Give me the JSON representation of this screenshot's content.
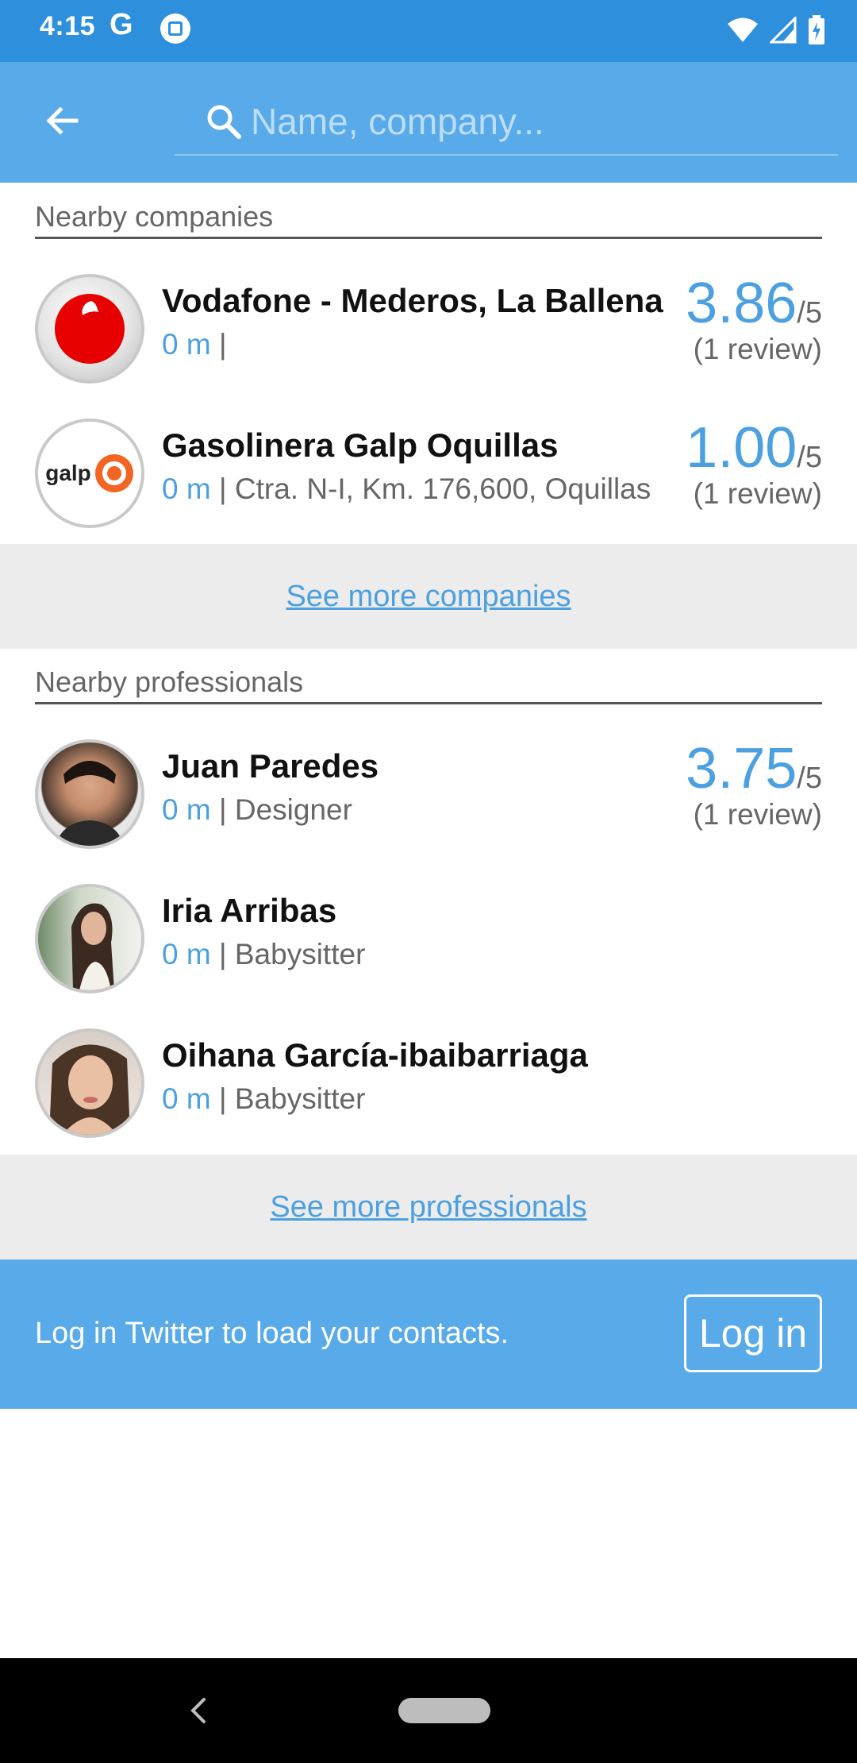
{
  "status_bar": {
    "time": "4:15",
    "g_label": "G",
    "icons": [
      "google-icon",
      "gallery-icon",
      "wifi-icon",
      "signal-icon",
      "battery-icon"
    ]
  },
  "search": {
    "placeholder": "Name, company..."
  },
  "companies": {
    "section_title": "Nearby companies",
    "items": [
      {
        "name": "Vodafone - Mederos, La Ballena",
        "distance": "0 m",
        "separator": "|",
        "detail": "",
        "rating": "3.86",
        "rating_max": "/5",
        "reviews": "(1 review)"
      },
      {
        "name": "Gasolinera Galp Oquillas",
        "distance": "0 m",
        "separator": "|",
        "detail": "Ctra. N-I, Km. 176,600, Oquillas",
        "rating": "1.00",
        "rating_max": "/5",
        "reviews": "(1 review)"
      }
    ],
    "see_more": "See more companies"
  },
  "galp_logo_text": "galp",
  "professionals": {
    "section_title": "Nearby professionals",
    "items": [
      {
        "name": "Juan Paredes",
        "distance": "0 m",
        "separator": "|",
        "detail": "Designer",
        "rating": "3.75",
        "rating_max": "/5",
        "reviews": "(1 review)"
      },
      {
        "name": "Iria Arribas",
        "distance": "0 m",
        "separator": "|",
        "detail": "Babysitter"
      },
      {
        "name": "Oihana García-ibaibarriaga",
        "distance": "0 m",
        "separator": "|",
        "detail": "Babysitter"
      }
    ],
    "see_more": "See more professionals"
  },
  "twitter": {
    "message": "Log in Twitter to load your contacts.",
    "login_label": "Log in"
  },
  "colors": {
    "status_bar": "#2e8fdc",
    "app_bar": "#58aae8",
    "accent": "#4da0e0",
    "see_more_bg": "#ececec",
    "vodafone_red": "#e60000",
    "galp_orange": "#f26522"
  }
}
